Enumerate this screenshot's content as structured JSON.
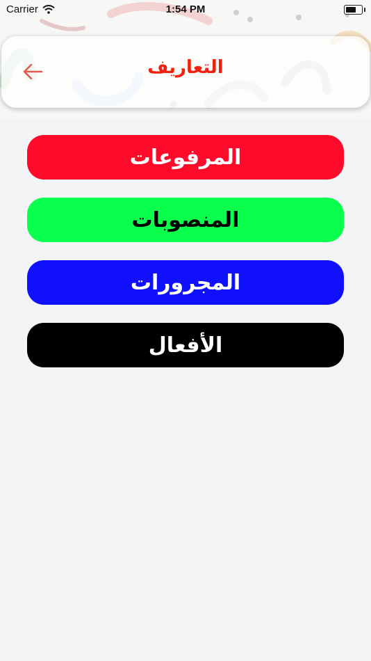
{
  "status_bar": {
    "carrier": "Carrier",
    "time": "1:54 PM"
  },
  "header": {
    "title": "التعاريف",
    "title_color": "#f2200f",
    "back_icon": "arrow-left-icon"
  },
  "menu": [
    {
      "label": "المرفوعات",
      "background": "#ff0a2a",
      "color": "#ffffff"
    },
    {
      "label": "المنصوبات",
      "background": "#0bff4d",
      "color": "#000000"
    },
    {
      "label": "المجرورات",
      "background": "#1010ff",
      "color": "#ffffff"
    },
    {
      "label": "الأفعال",
      "background": "#000000",
      "color": "#ffffff"
    }
  ]
}
